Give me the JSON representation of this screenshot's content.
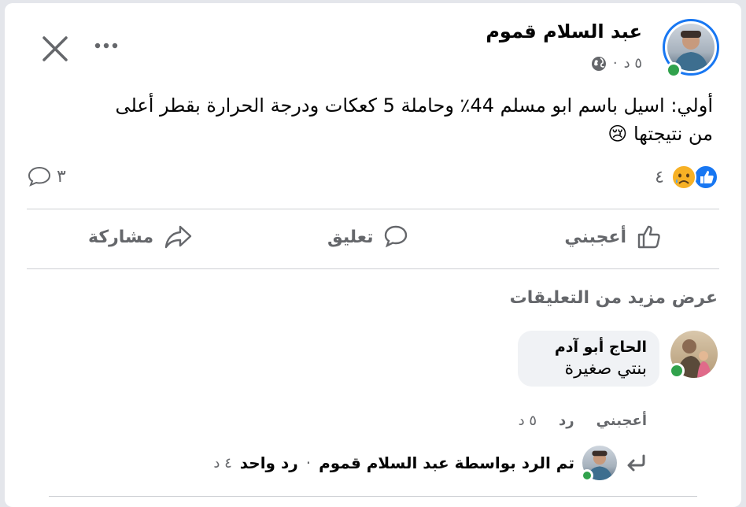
{
  "post": {
    "author": "عبد السلام قموم",
    "time": "٥ د",
    "privacy_icon": "globe-icon",
    "separator": "·",
    "text_line1": "أولي: اسيل باسم ابو مسلم 44٪ وحاملة 5 كعكات ودرجة الحرارة بقطر أعلى",
    "text_line2": "من نتيجتها",
    "text_emoji": "😢",
    "reactions_count": "٤",
    "comments_count": "٣"
  },
  "actions": {
    "like": "أعجبني",
    "comment": "تعليق",
    "share": "مشاركة"
  },
  "comments_section": {
    "view_more": "عرض مزيد من التعليقات",
    "comment": {
      "author": "الحاج أبو آدم",
      "text": "بنتي صغيرة",
      "like": "أعجبني",
      "reply": "رد",
      "time": "٥ د"
    },
    "reply_summary": {
      "text": "تم الرد بواسطة عبد السلام قموم",
      "dot": "·",
      "count_text": "رد واحد",
      "time": "٤ د"
    }
  },
  "colors": {
    "like_blue": "#1877f2",
    "online_green": "#31a24c",
    "muted": "#65676b",
    "bubble": "#f0f2f5"
  }
}
